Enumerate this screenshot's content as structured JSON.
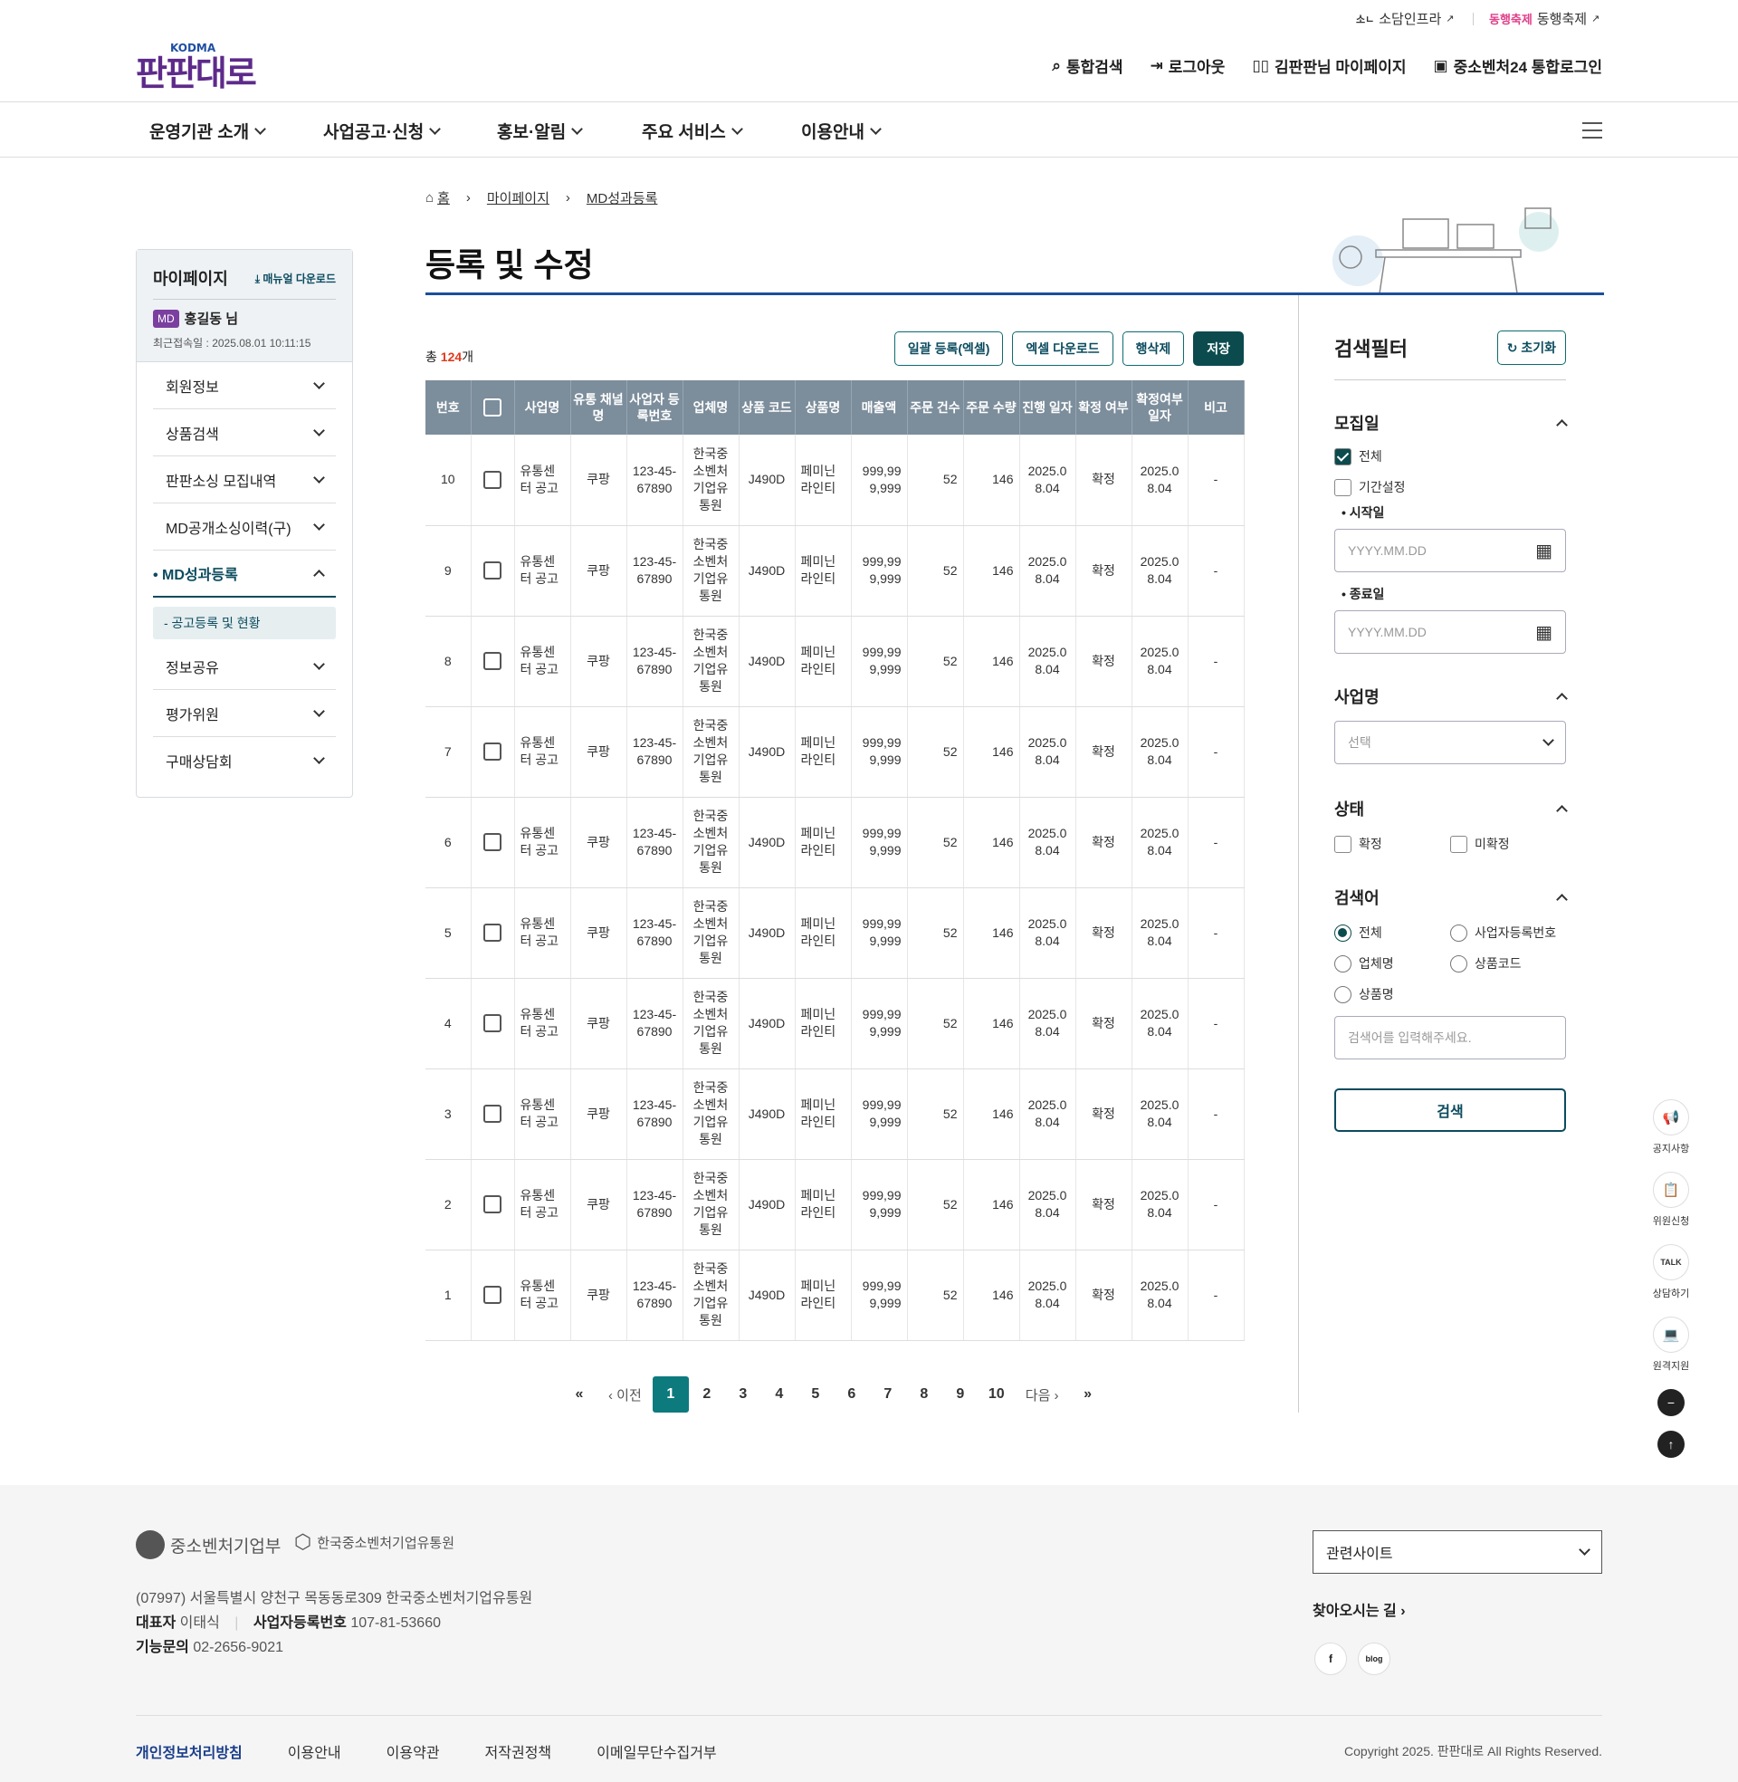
{
  "util": {
    "link1": "소담인프라",
    "link2_brand": "동행축제",
    "link2": "동행축제"
  },
  "brand": {
    "logo": "판판대로",
    "logo_sub": "KODMA"
  },
  "header": {
    "search": "통합검색",
    "logout": "로그아웃",
    "mypage": "김판판님 마이페이지",
    "login24": "중소벤처24 통합로그인"
  },
  "gnb": [
    "운영기관 소개",
    "사업공고·신청",
    "홍보·알림",
    "주요 서비스",
    "이용안내"
  ],
  "sidebar": {
    "title": "마이페이지",
    "manual": "매뉴얼 다운로드",
    "badge": "MD",
    "user": "홍길동 님",
    "last_login": "최근접속일 : 2025.08.01 10:11:15",
    "items": [
      {
        "label": "회원정보"
      },
      {
        "label": "상품검색"
      },
      {
        "label": "판판소싱 모집내역"
      },
      {
        "label": "MD공개소싱이력(구)"
      },
      {
        "label": "MD성과등록"
      },
      {
        "label": "정보공유"
      },
      {
        "label": "평가위원"
      },
      {
        "label": "구매상담회"
      }
    ],
    "sub": "- 공고등록 및 현황"
  },
  "breadcrumb": [
    "홈",
    "마이페이지",
    "MD성과등록"
  ],
  "page_title": "등록 및 수정",
  "total": {
    "prefix": "총 ",
    "count": "124",
    "suffix": "개"
  },
  "buttons": {
    "bulk": "일괄 등록(엑셀)",
    "excel": "엑셀 다운로드",
    "delete": "행삭제",
    "save": "저장"
  },
  "table": {
    "headers": [
      "번호",
      "",
      "사업명",
      "유통 채널명",
      "사업자 등록번호",
      "업체명",
      "상품 코드",
      "상품명",
      "매출액",
      "주문 건수",
      "주문 수량",
      "진행 일자",
      "확정 여부",
      "확정여부 일자",
      "비고"
    ],
    "rows": [
      [
        "10",
        "유통센터 공고",
        "쿠팡",
        "123-45-67890",
        "한국중소벤처기업유통원",
        "J490D",
        "페미닌라인티",
        "999,999,999",
        "52",
        "146",
        "2025.08.04",
        "확정",
        "2025.08.04",
        "-"
      ],
      [
        "9",
        "유통센터 공고",
        "쿠팡",
        "123-45-67890",
        "한국중소벤처기업유통원",
        "J490D",
        "페미닌라인티",
        "999,999,999",
        "52",
        "146",
        "2025.08.04",
        "확정",
        "2025.08.04",
        "-"
      ],
      [
        "8",
        "유통센터 공고",
        "쿠팡",
        "123-45-67890",
        "한국중소벤처기업유통원",
        "J490D",
        "페미닌라인티",
        "999,999,999",
        "52",
        "146",
        "2025.08.04",
        "확정",
        "2025.08.04",
        "-"
      ],
      [
        "7",
        "유통센터 공고",
        "쿠팡",
        "123-45-67890",
        "한국중소벤처기업유통원",
        "J490D",
        "페미닌라인티",
        "999,999,999",
        "52",
        "146",
        "2025.08.04",
        "확정",
        "2025.08.04",
        "-"
      ],
      [
        "6",
        "유통센터 공고",
        "쿠팡",
        "123-45-67890",
        "한국중소벤처기업유통원",
        "J490D",
        "페미닌라인티",
        "999,999,999",
        "52",
        "146",
        "2025.08.04",
        "확정",
        "2025.08.04",
        "-"
      ],
      [
        "5",
        "유통센터 공고",
        "쿠팡",
        "123-45-67890",
        "한국중소벤처기업유통원",
        "J490D",
        "페미닌라인티",
        "999,999,999",
        "52",
        "146",
        "2025.08.04",
        "확정",
        "2025.08.04",
        "-"
      ],
      [
        "4",
        "유통센터 공고",
        "쿠팡",
        "123-45-67890",
        "한국중소벤처기업유통원",
        "J490D",
        "페미닌라인티",
        "999,999,999",
        "52",
        "146",
        "2025.08.04",
        "확정",
        "2025.08.04",
        "-"
      ],
      [
        "3",
        "유통센터 공고",
        "쿠팡",
        "123-45-67890",
        "한국중소벤처기업유통원",
        "J490D",
        "페미닌라인티",
        "999,999,999",
        "52",
        "146",
        "2025.08.04",
        "확정",
        "2025.08.04",
        "-"
      ],
      [
        "2",
        "유통센터 공고",
        "쿠팡",
        "123-45-67890",
        "한국중소벤처기업유통원",
        "J490D",
        "페미닌라인티",
        "999,999,999",
        "52",
        "146",
        "2025.08.04",
        "확정",
        "2025.08.04",
        "-"
      ],
      [
        "1",
        "유통센터 공고",
        "쿠팡",
        "123-45-67890",
        "한국중소벤처기업유통원",
        "J490D",
        "페미닌라인티",
        "999,999,999",
        "52",
        "146",
        "2025.08.04",
        "확정",
        "2025.08.04",
        "-"
      ]
    ]
  },
  "pager": {
    "prev": "이전",
    "next": "다음",
    "pages": [
      "1",
      "2",
      "3",
      "4",
      "5",
      "6",
      "7",
      "8",
      "9",
      "10"
    ],
    "current": "1"
  },
  "filter": {
    "title": "검색필터",
    "reset": "초기화",
    "recruit": "모집일",
    "all": "전체",
    "period": "기간설정",
    "start": "시작일",
    "end": "종료일",
    "date_ph": "YYYY.MM.DD",
    "biz": "사업명",
    "select_ph": "선택",
    "status": "상태",
    "confirmed": "확정",
    "unconfirmed": "미확정",
    "keyword": "검색어",
    "kw_all": "전체",
    "kw_bizno": "사업자등록번호",
    "kw_company": "업체명",
    "kw_code": "상품코드",
    "kw_product": "상품명",
    "kw_ph": "검색어를 입력해주세요.",
    "search": "검색"
  },
  "quick": [
    "공지사항",
    "위원신청",
    "상담하기",
    "원격지원"
  ],
  "footer": {
    "org1": "중소벤처기업부",
    "org2": "한국중소벤처기업유통원",
    "address": "(07997) 서울특별시 양천구 목동동로309 한국중소벤처기업유통원",
    "ceo_label": "대표자",
    "ceo": "이태식",
    "bizno_label": "사업자등록번호",
    "bizno": "107-81-53660",
    "tel_label": "기능문의",
    "tel": "02-2656-9021",
    "related": "관련사이트",
    "way": "찾아오시는 길",
    "links": [
      "개인정보처리방침",
      "이용안내",
      "이용약관",
      "저작권정책",
      "이메일무단수집거부"
    ],
    "copyright": "Copyright 2025. 판판대로 All Rights Reserved.",
    "sns": [
      "f",
      "blog"
    ]
  },
  "colors": {
    "accent": "#0b4b4e",
    "header_bg": "#7c8d9b",
    "title_line": "#1a4e9c",
    "count": "#e03a1e"
  }
}
